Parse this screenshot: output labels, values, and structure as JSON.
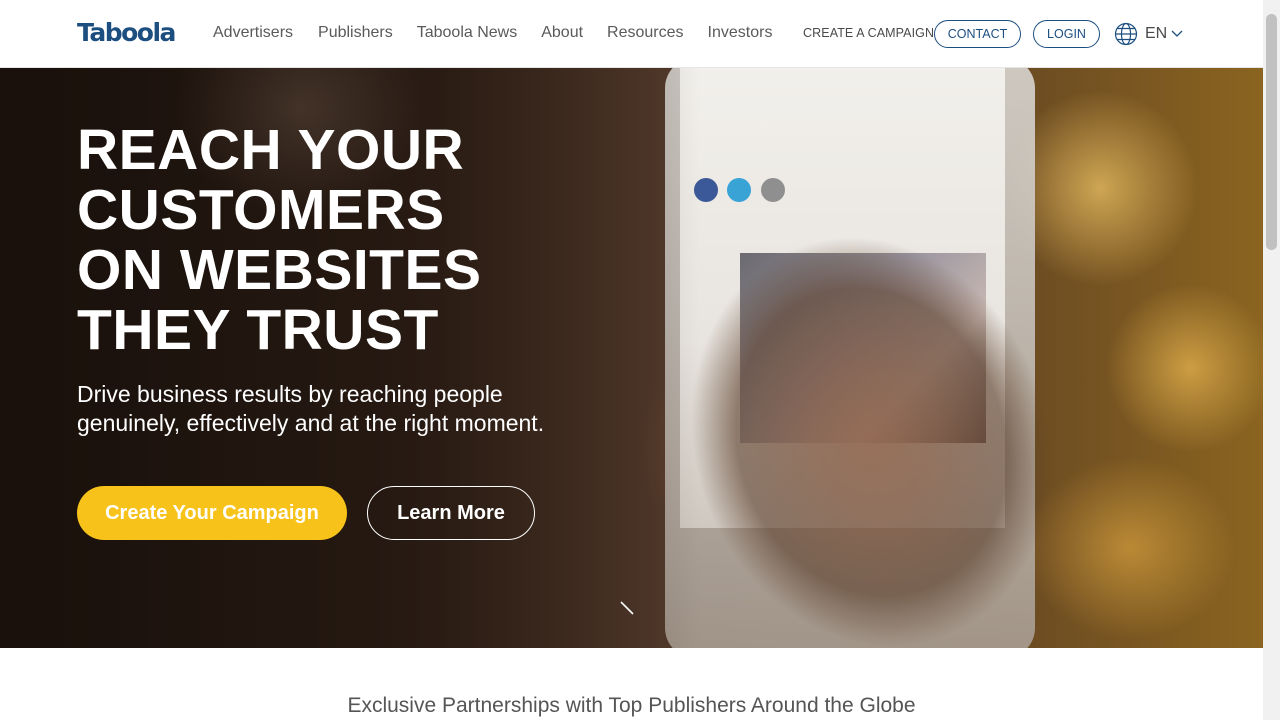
{
  "header": {
    "logo": "Taboola",
    "nav": [
      "Advertisers",
      "Publishers",
      "Taboola News",
      "About",
      "Resources",
      "Investors"
    ],
    "create_campaign": "CREATE A CAMPAIGN",
    "contact": "CONTACT",
    "login": "LOGIN",
    "language": "EN",
    "brand_color": "#1c4e80"
  },
  "hero": {
    "headline": [
      "REACH YOUR",
      "CUSTOMERS",
      "ON WEBSITES",
      "THEY TRUST"
    ],
    "subline": [
      "Drive business results by reaching people",
      "genuinely, effectively and at the right moment."
    ],
    "primary_button": "Create Your Campaign",
    "secondary_button": "Learn More",
    "accent_color": "#f7c31a"
  },
  "partners": {
    "heading": "Exclusive Partnerships with Top Publishers Around the Globe"
  }
}
